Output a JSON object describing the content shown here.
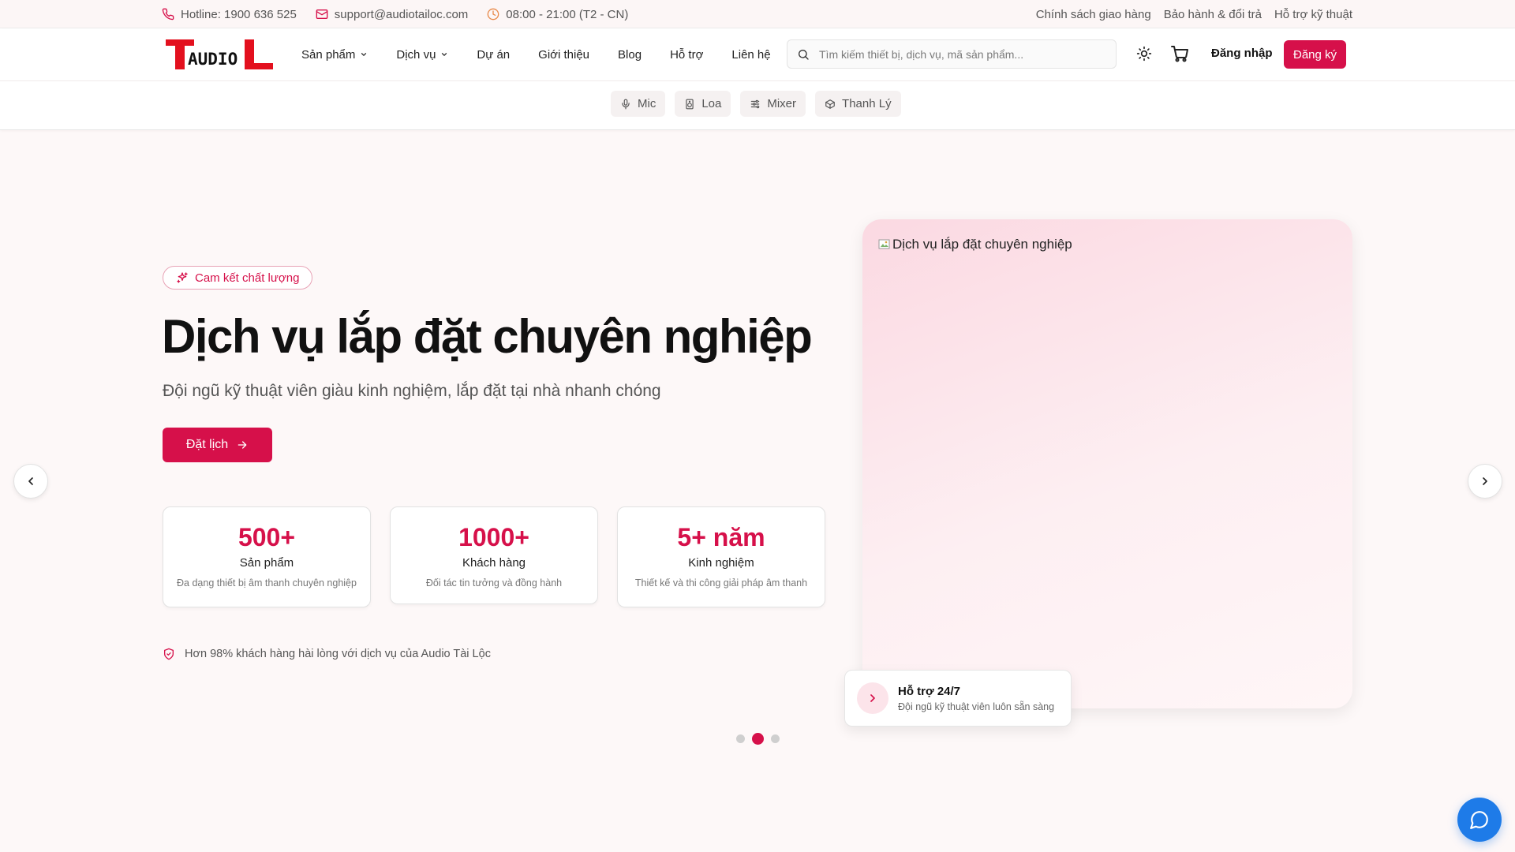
{
  "topbar": {
    "hotline": "Hotline: 1900 636 525",
    "email": "support@audiotailoc.com",
    "hours": "08:00 - 21:00 (T2 - CN)",
    "links": [
      "Chính sách giao hàng",
      "Bảo hành & đổi trả",
      "Hỗ trợ kỹ thuật"
    ]
  },
  "header": {
    "logo_text": "AUDIO",
    "nav": [
      "Sản phẩm",
      "Dịch vụ",
      "Dự án",
      "Giới thiệu",
      "Blog",
      "Hỗ trợ",
      "Liên hệ"
    ],
    "search_placeholder": "Tìm kiếm thiết bị, dịch vụ, mã sản phẩm...",
    "login": "Đăng nhập",
    "register": "Đăng ký",
    "categories": [
      "Mic",
      "Loa",
      "Mixer",
      "Thanh Lý"
    ]
  },
  "hero": {
    "badge": "Cam kết chất lượng",
    "title": "Dịch vụ lắp đặt chuyên nghiệp",
    "subtitle": "Đội ngũ kỹ thuật viên giàu kinh nghiệm, lắp đặt tại nhà nhanh chóng",
    "cta": "Đặt lịch",
    "image_alt": "Dịch vụ lắp đặt chuyên nghiệp",
    "stats": [
      {
        "value": "500+",
        "label": "Sản phẩm",
        "desc": "Đa dạng thiết bị âm thanh chuyên nghiệp"
      },
      {
        "value": "1000+",
        "label": "Khách hàng",
        "desc": "Đối tác tin tưởng và đồng hành"
      },
      {
        "value": "5+ năm",
        "label": "Kinh nghiệm",
        "desc": "Thiết kế và thi công giải pháp âm thanh"
      }
    ],
    "assurance": "Hơn 98% khách hàng hài lòng với dịch vụ của Audio Tài Lộc",
    "support": {
      "title": "Hỗ trợ 24/7",
      "desc": "Đội ngũ kỹ thuật viên luôn sẵn sàng"
    },
    "slides": {
      "count": 3,
      "active_index": 1
    }
  },
  "colors": {
    "accent": "#d6104a",
    "chat": "#1e7be8"
  },
  "icons": [
    "phone-icon",
    "mail-icon",
    "clock-icon",
    "chevron-down-icon",
    "search-icon",
    "sun-icon",
    "cart-icon",
    "mic-icon",
    "speaker-icon",
    "sliders-icon",
    "box-icon",
    "sparkles-icon",
    "arrow-right-icon",
    "shield-check-icon",
    "chevron-right-icon",
    "chevron-left-icon",
    "chat-icon"
  ]
}
